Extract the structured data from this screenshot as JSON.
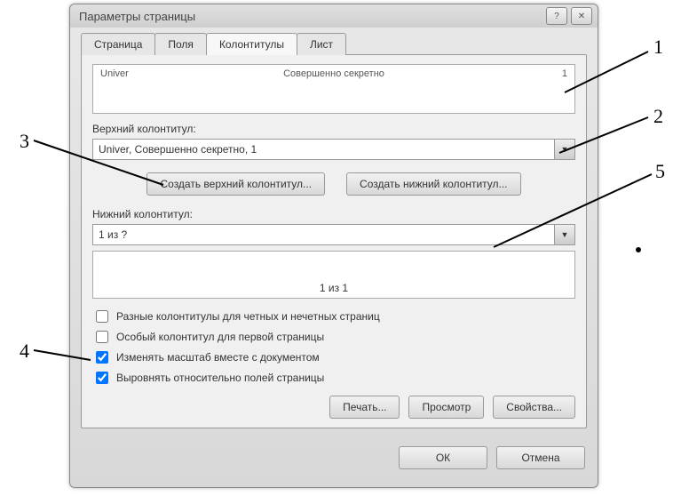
{
  "window": {
    "title": "Параметры страницы"
  },
  "tabs": {
    "page": "Страница",
    "fields": "Поля",
    "headers": "Колонтитулы",
    "sheet": "Лист"
  },
  "header_preview": {
    "left": "Univer",
    "center": "Совершенно секретно",
    "right": "1"
  },
  "labels": {
    "upper": "Верхний колонтитул:",
    "lower": "Нижний колонтитул:"
  },
  "header_combo": "Univer, Совершенно секретно, 1",
  "footer_combo": "1 из ?",
  "buttons": {
    "create_upper": "Создать верхний колонтитул...",
    "create_lower": "Создать нижний колонтитул...",
    "print": "Печать...",
    "preview": "Просмотр",
    "properties": "Свойства...",
    "ok": "ОК",
    "cancel": "Отмена"
  },
  "footer_preview_center": "1 из 1",
  "checks": {
    "odd_even": "Разные колонтитулы для четных и нечетных страниц",
    "first_page": "Особый колонтитул для первой страницы",
    "scale": "Изменять масштаб вместе с документом",
    "align": "Выровнять относительно полей страницы"
  },
  "annotations": {
    "n1": "1",
    "n2": "2",
    "n3": "3",
    "n4": "4",
    "n5": "5"
  }
}
